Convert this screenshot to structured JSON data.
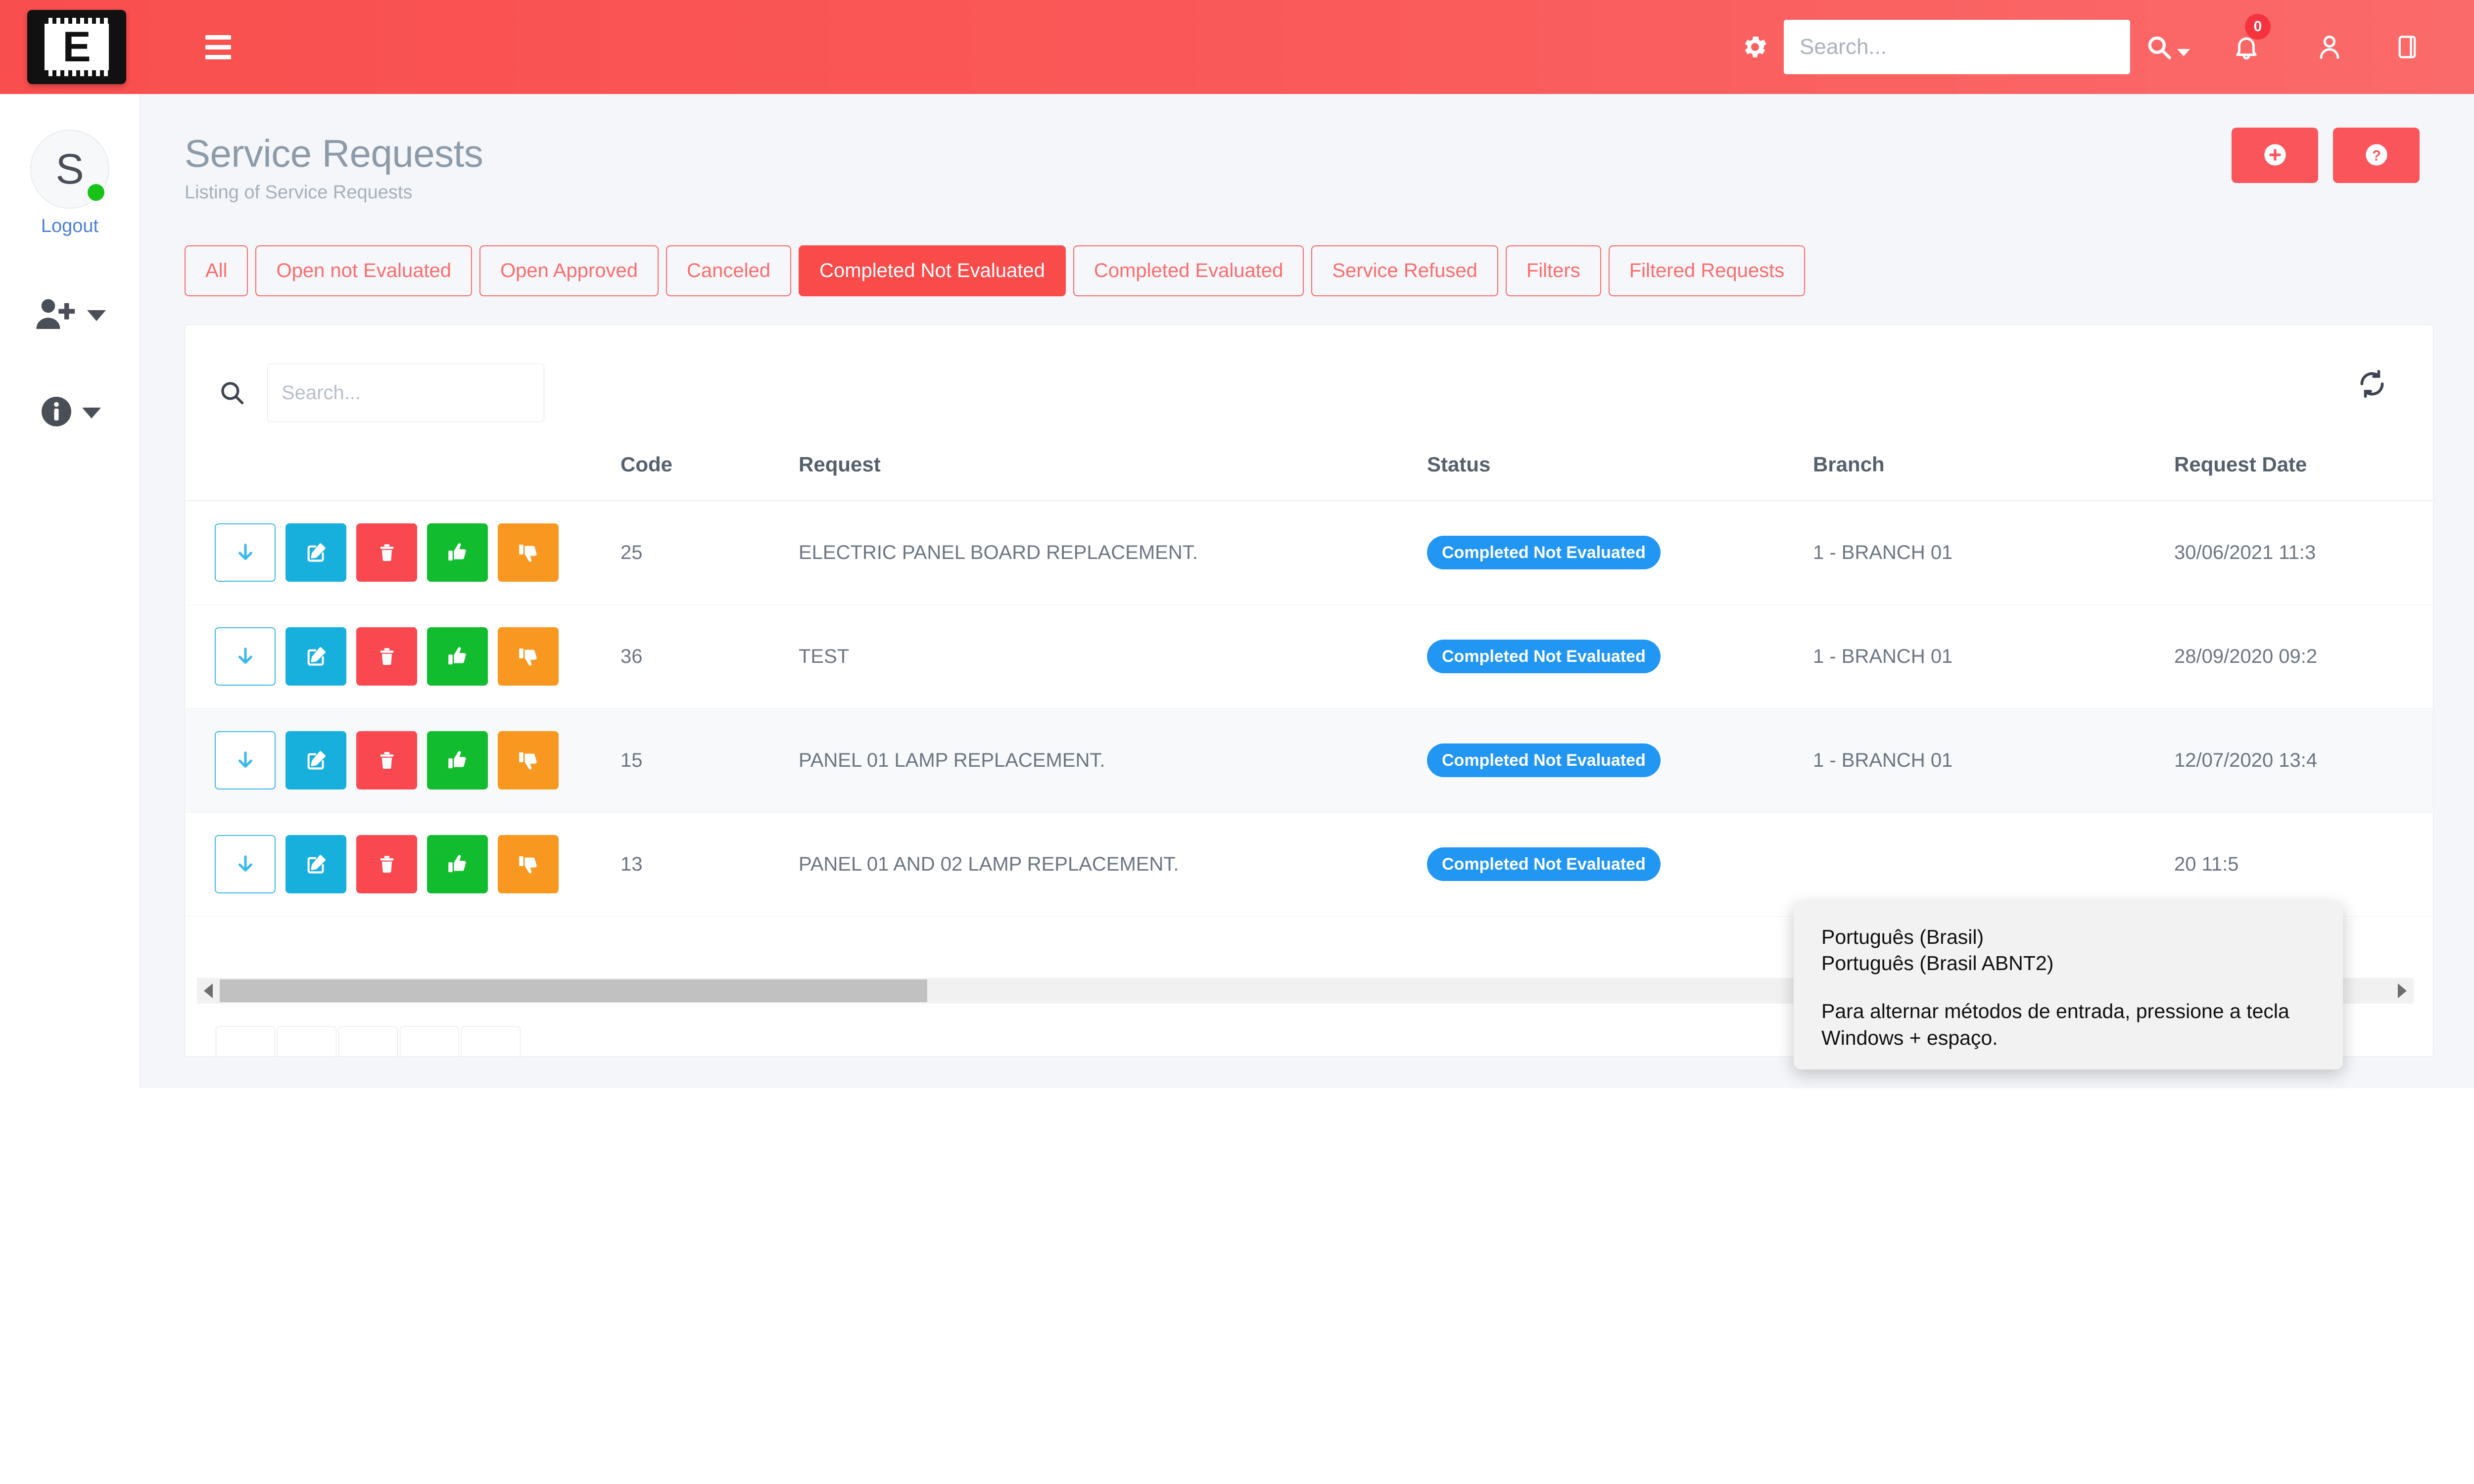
{
  "header": {
    "logo_letter": "E",
    "menu_icon": "hamburger-icon",
    "gear_icon": "gear-icon",
    "search_placeholder": "Search...",
    "search_value": "",
    "search_dropdown_icon": "search-dropdown-icon",
    "bell_icon": "bell-icon",
    "notification_count": "0",
    "user_icon": "user-icon",
    "panel_icon": "panel-toggle-icon"
  },
  "sidebar": {
    "avatar_letter": "S",
    "status": "online",
    "logout_label": "Logout",
    "items": [
      {
        "icon": "user-add-icon",
        "label": ""
      },
      {
        "icon": "info-circle-icon",
        "label": ""
      }
    ]
  },
  "page": {
    "title": "Service Requests",
    "subtitle": "Listing of Service Requests",
    "add_button_icon": "plus-circle-icon",
    "help_button_icon": "question-circle-icon",
    "accent_color": "#fa4b4b",
    "tab_border_color": "#f96a6a",
    "badge_color": "#2196f3"
  },
  "tabs": [
    {
      "label": "All",
      "active": false
    },
    {
      "label": "Open not Evaluated",
      "active": false
    },
    {
      "label": "Open Approved",
      "active": false
    },
    {
      "label": "Canceled",
      "active": false
    },
    {
      "label": "Completed Not Evaluated",
      "active": true
    },
    {
      "label": "Completed Evaluated",
      "active": false
    },
    {
      "label": "Service Refused",
      "active": false
    },
    {
      "label": "Filters",
      "active": false
    },
    {
      "label": "Filtered Requests",
      "active": false
    }
  ],
  "toolbar": {
    "search_icon": "search-icon",
    "search_placeholder": "Search...",
    "search_value": "",
    "refresh_icon": "refresh-icon"
  },
  "table": {
    "columns": [
      "",
      "Code",
      "Request",
      "Status",
      "Branch",
      "Request Date"
    ],
    "row_actions": [
      {
        "icon": "download-icon",
        "style": "outline-blue"
      },
      {
        "icon": "edit-icon",
        "style": "solid-cyan"
      },
      {
        "icon": "trash-icon",
        "style": "solid-red"
      },
      {
        "icon": "thumbs-up-icon",
        "style": "solid-green"
      },
      {
        "icon": "thumbs-down-icon",
        "style": "solid-orange"
      }
    ],
    "rows": [
      {
        "code": "25",
        "request": "ELECTRIC PANEL BOARD REPLACEMENT.",
        "status": "Completed Not Evaluated",
        "branch": "1 - BRANCH 01",
        "date": "30/06/2021 11:3"
      },
      {
        "code": "36",
        "request": "TEST",
        "status": "Completed Not Evaluated",
        "branch": "1 - BRANCH 01",
        "date": "28/09/2020 09:2"
      },
      {
        "code": "15",
        "request": "PANEL 01 LAMP REPLACEMENT.",
        "status": "Completed Not Evaluated",
        "branch": "1 - BRANCH 01",
        "date": "12/07/2020 13:4"
      },
      {
        "code": "13",
        "request": "PANEL 01 AND 02 LAMP REPLACEMENT.",
        "status": "Completed Not Evaluated",
        "branch": "",
        "date": "20 11:5"
      }
    ]
  },
  "ime_popup": {
    "line1": "Português (Brasil)",
    "line2": "Português (Brasil ABNT2)",
    "hint": "Para alternar métodos de entrada, pressione a tecla Windows + espaço."
  }
}
